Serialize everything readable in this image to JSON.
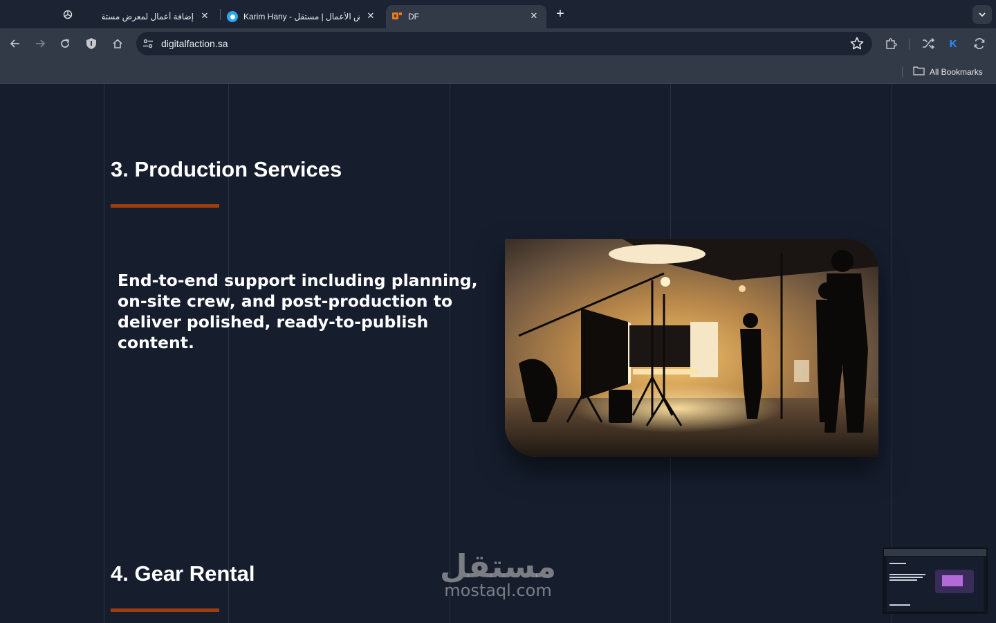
{
  "browser": {
    "tabs": [
      {
        "title": "إضافة أعمال لمعرض مستقل",
        "favicon": "openai-icon",
        "active": false
      },
      {
        "title": "Karim Hany - معرض الأعمال | مستقل",
        "favicon": "mostaql-icon",
        "active": false
      },
      {
        "title": "DF",
        "favicon": "df-icon",
        "active": true
      }
    ],
    "address_bar": {
      "url": "digitalfaction.sa"
    },
    "bookmarks": {
      "all_bookmarks_label": "All Bookmarks"
    },
    "profile_initial": "K"
  },
  "page": {
    "sections": [
      {
        "title": "3. Production Services",
        "description": "End-to-end support including planning, on-site crew, and post-production to deliver polished, ready-to-publish content."
      },
      {
        "title": "4. Gear Rental"
      }
    ],
    "watermark": {
      "arabic": "مستقل",
      "latin": "mostaql.com"
    }
  },
  "colors": {
    "page_background": "#161e2e",
    "accent_underline": "#a03c0f",
    "chrome_toolbar": "#333a47",
    "tabstrip": "#1c2433"
  }
}
